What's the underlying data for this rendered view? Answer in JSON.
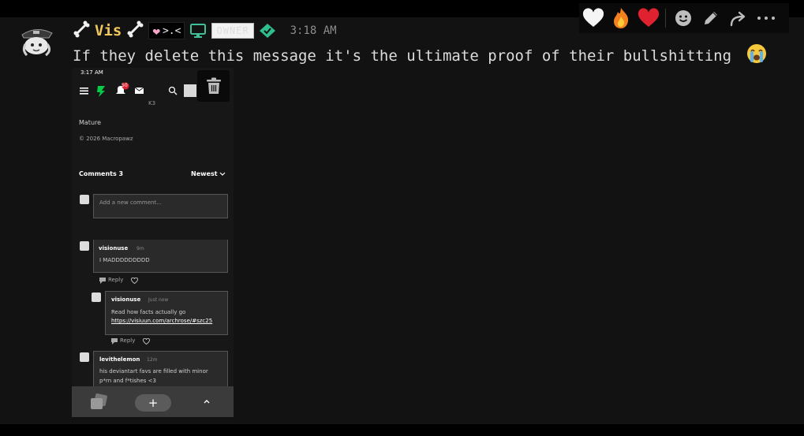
{
  "message": {
    "author": "Vis",
    "author_prefix_icon": "bone-icon",
    "author_suffix_icon": "bone-icon",
    "tag_text": ">.<",
    "tag_icon": "pink-heart-icon",
    "badge_icon": "monitor-icon",
    "role_label": "OWNER",
    "role_icon": "diamond-icon",
    "timestamp": "3:18 AM",
    "text": "If they delete this message it's the ultimate proof of their bullshitting",
    "text_emoji": "loudly-crying-face-icon"
  },
  "toolbar": {
    "reactions": [
      "white-heart-icon",
      "fire-icon",
      "red-heart-icon"
    ],
    "actions": [
      "add-reaction-icon",
      "edit-icon",
      "forward-icon",
      "more-icon"
    ]
  },
  "attachment": {
    "status_time": "3:17 AM",
    "notification_count": "50",
    "partial_top_text": "K3",
    "rating": "Mature",
    "copyright": "© 2026 Macropawz",
    "comments_header": "Comments 3",
    "sort_label": "Newest",
    "comment_placeholder": "Add a new comment...",
    "comments": [
      {
        "user": "visionuse",
        "time": "9m",
        "text": "I MADDDDDDDDD",
        "reply_label": "Reply"
      },
      {
        "user": "visionuse",
        "time": "Just now",
        "text": "Read how facts actually go",
        "link": "https://visiuun.com/archrose/#szc25",
        "reply_label": "Reply"
      },
      {
        "user": "levithelemon",
        "time": "12m",
        "text_line1": "his deviantart favs are filled with minor",
        "text_line2": "p*rn and f*tishes <3"
      }
    ],
    "add_button": "+",
    "delete_icon": "trash-icon"
  }
}
